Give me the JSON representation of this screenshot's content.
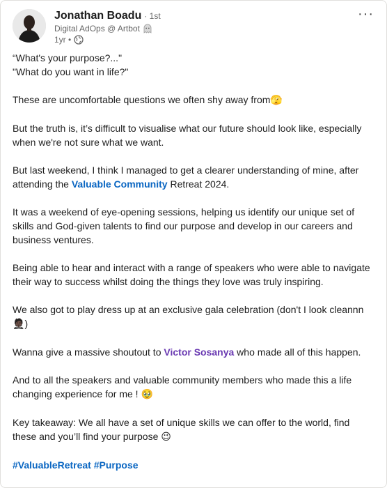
{
  "author": {
    "name": "Jonathan Boadu",
    "degree": "· 1st",
    "headline": "Digital AdOps @ Artbot",
    "time": "1yr •"
  },
  "icons": {
    "more": "more-options-icon",
    "globe": "globe-icon",
    "badge": "ghost-icon"
  },
  "colors": {
    "link": "#0a66c2",
    "mention": "#6a3ab2"
  },
  "post": {
    "q1": "“What's your purpose?...\"",
    "q2": "\"What do you want in life?\"",
    "p2": "These are uncomfortable questions we often shy away from",
    "p2_emoji": "🫣",
    "p3": "But the truth is, it’s difficult to visualise what our future should look like, especially when we're not sure what we want.",
    "p4_pre": "But last weekend, I think I managed to get a clearer understanding of mine, after attending the ",
    "p4_link": "Valuable Community",
    "p4_post": " Retreat 2024.",
    "p5": "It was a weekend of eye-opening sessions, helping us identify our unique set of skills and God-given talents to find our purpose and develop in our careers and business ventures.",
    "p6": "Being able to hear and interact with a range of speakers who were able to navigate their way to success whilst doing the things they love was truly inspiring.",
    "p7_pre": "We also got to play dress up at an exclusive gala celebration (don't I look cleannn ",
    "p7_emoji": "🤵🏿",
    "p7_post": ")",
    "p8_pre": "Wanna give a massive shoutout to ",
    "p8_mention": "Victor Sosanya",
    "p8_post": " who made all of this happen.",
    "p9_pre": "And to all the speakers and valuable community members who made this a life changing experience for me ! ",
    "p9_emoji": "🥹",
    "p10_pre": "Key takeaway: We all have a set of unique skills we can offer to the world, find these and you’ll find your purpose ",
    "p10_emoji": "😉",
    "tag1": "#ValuableRetreat",
    "tag2": "#Purpose"
  }
}
